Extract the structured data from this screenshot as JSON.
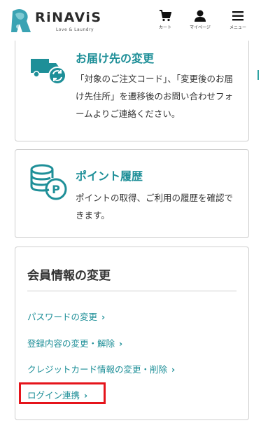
{
  "header": {
    "logo_text": "RiNAViS",
    "logo_sub": "Love & Laundry",
    "cart_label": "カート",
    "mypage_label": "マイページ",
    "menu_label": "メニュー"
  },
  "cards": {
    "address": {
      "title": "お届け先の変更",
      "desc": "「対象のご注文コード」、「変更後のお届け先住所」を遷移後のお問い合わせフォームよりご連絡ください。",
      "icon": "delivery-truck-icon"
    },
    "point": {
      "title": "ポイント履歴",
      "desc": "ポイントの取得、ご利用の履歴を確認できます。",
      "icon": "coins-icon"
    }
  },
  "member": {
    "title": "会員情報の変更",
    "links": [
      {
        "label": "パスワードの変更"
      },
      {
        "label": "登録内容の変更・解除"
      },
      {
        "label": "クレジットカード情報の変更・削除"
      },
      {
        "label": "ログイン連携"
      }
    ],
    "chevron": "›"
  },
  "colors": {
    "accent": "#1e8f98",
    "highlight": "#e5141b"
  }
}
